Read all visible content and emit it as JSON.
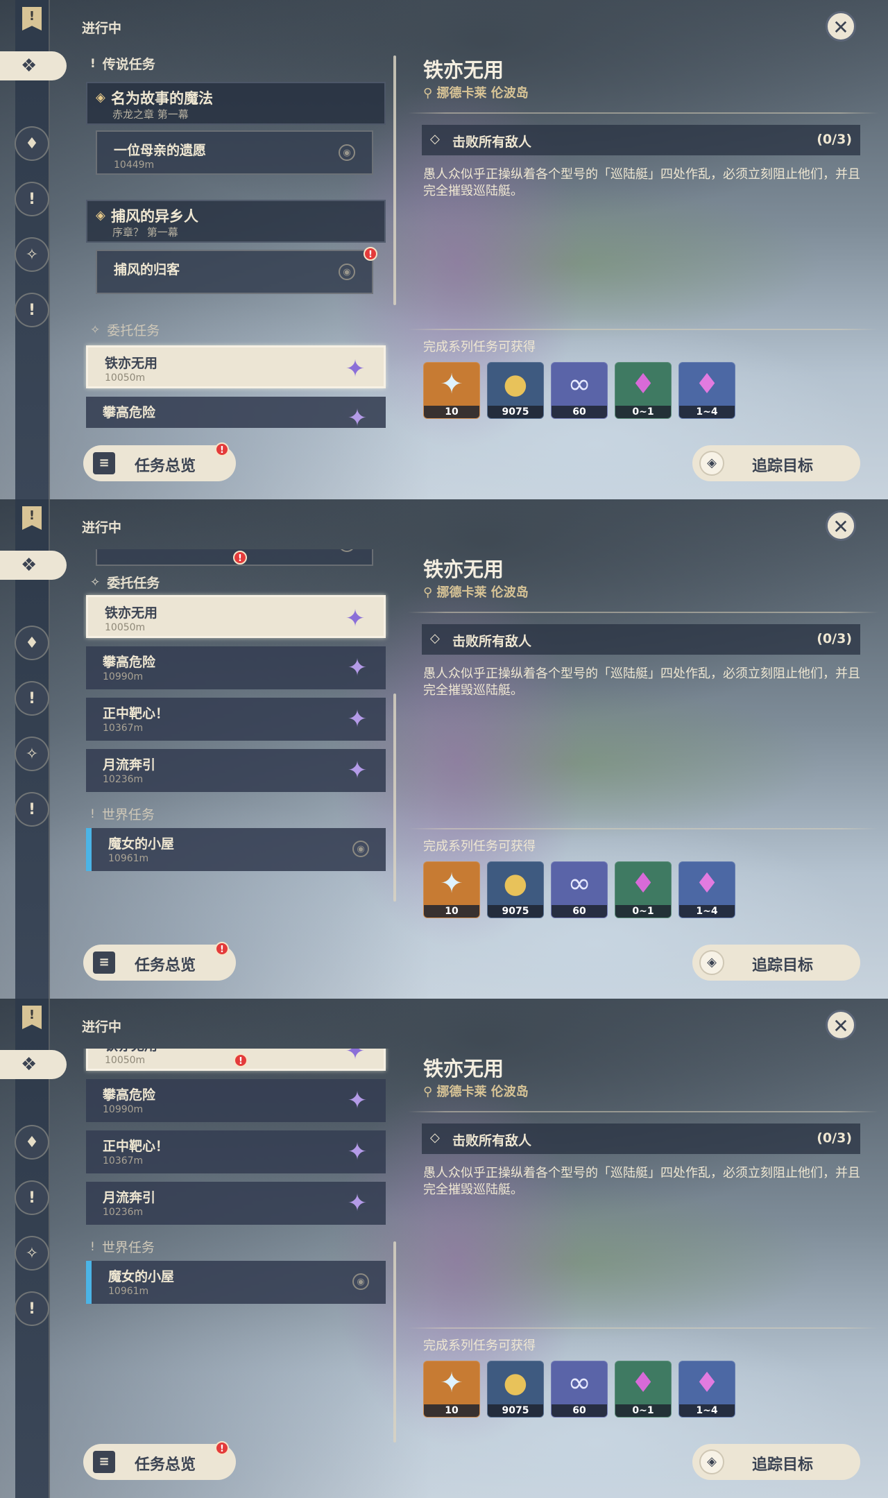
{
  "common": {
    "status": "进行中",
    "close_icon": "✕",
    "quest": {
      "title": "铁亦无用",
      "location": "挪德卡莱 伦波岛",
      "objective": "击败所有敌人",
      "objective_count": "(0/3)",
      "description": "愚人众似乎正操纵着各个型号的「巡陆艇」四处作乱，必须立刻阻止他们，并且完全摧毁巡陆艇。",
      "rewards_heading": "完成系列任务可获得",
      "rewards": [
        {
          "icon": "primogem-icon",
          "glyph": "✦",
          "count": "10",
          "color": "#c77b33"
        },
        {
          "icon": "mora-icon",
          "glyph": "●",
          "count": "9075",
          "color": "#3e5a80"
        },
        {
          "icon": "exp-icon",
          "glyph": "∞",
          "count": "60",
          "color": "#5a64a8"
        },
        {
          "icon": "crystal-icon",
          "glyph": "♦",
          "count": "0~1",
          "color": "#3f7a62"
        },
        {
          "icon": "crystal-chunk-icon",
          "glyph": "♦",
          "count": "1~4",
          "color": "#4c68a4"
        }
      ]
    },
    "overview_label": "任务总览",
    "track_label": "追踪目标"
  },
  "panel1": {
    "legend_section": "传说任务",
    "archon1_title": "名为故事的魔法",
    "archon1_sub": "赤龙之章 第一幕",
    "sub1_title": "一位母亲的遗愿",
    "sub1_meta": "10449m",
    "archon2_title": "捕风的异乡人",
    "archon2_sub": "序章？ 第一幕",
    "sub2_title": "捕风的归客",
    "commission_section": "委托任务",
    "row1_title": "铁亦无用",
    "row1_meta": "10050m",
    "row2_title": "攀高危险"
  },
  "panel2": {
    "commission_section": "委托任务",
    "rows": [
      {
        "title": "铁亦无用",
        "meta": "10050m"
      },
      {
        "title": "攀高危险",
        "meta": "10990m"
      },
      {
        "title": "正中靶心！",
        "meta": "10367m"
      },
      {
        "title": "月流奔引",
        "meta": "10236m"
      }
    ],
    "world_section": "世界任务",
    "world_title": "魔女的小屋",
    "world_meta": "10961m"
  },
  "panel3": {
    "rows": [
      {
        "title": "铁亦无用",
        "meta": "10050m"
      },
      {
        "title": "攀高危险",
        "meta": "10990m"
      },
      {
        "title": "正中靶心！",
        "meta": "10367m"
      },
      {
        "title": "月流奔引",
        "meta": "10236m"
      }
    ],
    "world_section": "世界任务",
    "world_title": "魔女的小屋",
    "world_meta": "10961m"
  }
}
